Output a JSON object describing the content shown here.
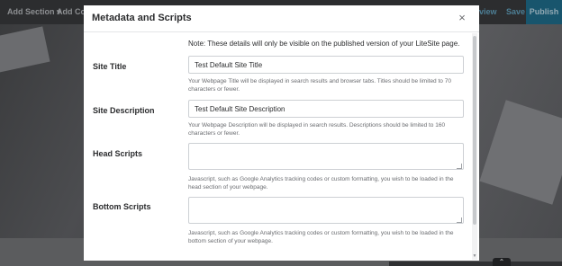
{
  "toolbar": {
    "add_section": "Add Section ▾",
    "add_content": "Add Cont",
    "view": "view",
    "save": "Save",
    "publish": "Publish"
  },
  "modal": {
    "title": "Metadata and Scripts",
    "close_glyph": "×",
    "note": "Note: These details will only be visible on the published version of your LiteSite page.",
    "site_title": {
      "label": "Site Title",
      "value": "Test Default Site Title",
      "help": "Your Webpage Title will be displayed in search results and browser tabs. Titles should be limited to 70 characters or fewer."
    },
    "site_description": {
      "label": "Site Description",
      "value": "Test Default Site Description",
      "help": "Your Webpage Description will be displayed in search results. Descriptions should be limited to 160 characters or fewer."
    },
    "head_scripts": {
      "label": "Head Scripts",
      "value": "",
      "help": "Javascript, such as Google Analytics tracking codes or custom formatting, you wish to be loaded in the head section of your webpage."
    },
    "bottom_scripts": {
      "label": "Bottom Scripts",
      "value": "",
      "help": "Javascript, such as Google Analytics tracking codes or custom formatting, you wish to be loaded in the bottom section of your webpage."
    }
  },
  "footer": {
    "chevron_glyph": "⌃"
  },
  "icons": {
    "close": "close-icon",
    "chevron_up": "chevron-up-icon",
    "resize": "resize-grip-icon"
  }
}
